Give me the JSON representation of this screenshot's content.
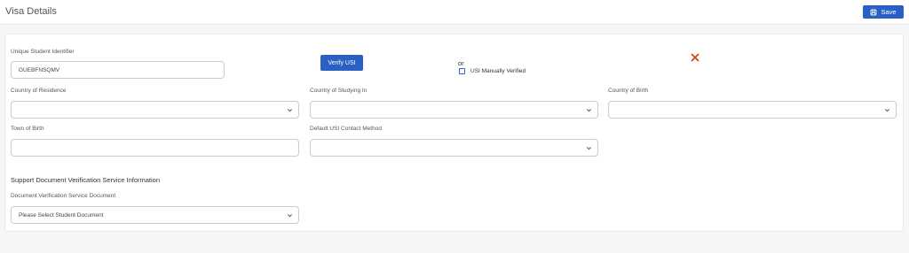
{
  "header": {
    "title": "Visa Details",
    "save_label": "Save"
  },
  "usi": {
    "label": "Unique Student Identifier",
    "value": "GUEBFNSQMV",
    "verify_label": "Verify USI",
    "or_text": "or",
    "manual_label": "USI Manually Verified",
    "manual_checked": false,
    "status_icon": "close-icon"
  },
  "fields": {
    "country_residence": {
      "label": "Country of Residence",
      "value": ""
    },
    "country_studying": {
      "label": "Country of Studying In",
      "value": ""
    },
    "country_birth": {
      "label": "Country of Birth",
      "value": ""
    },
    "town_birth": {
      "label": "Town of Birth",
      "value": ""
    },
    "contact_method": {
      "label": "Default USI Contact Method",
      "value": ""
    }
  },
  "dvs": {
    "section_title": "Support Document Verification Service Information",
    "doc_label": "Document Verification Service Document",
    "doc_placeholder": "Please Select Student Document"
  },
  "colors": {
    "primary": "#2a5fc4",
    "error": "#d9431a"
  }
}
